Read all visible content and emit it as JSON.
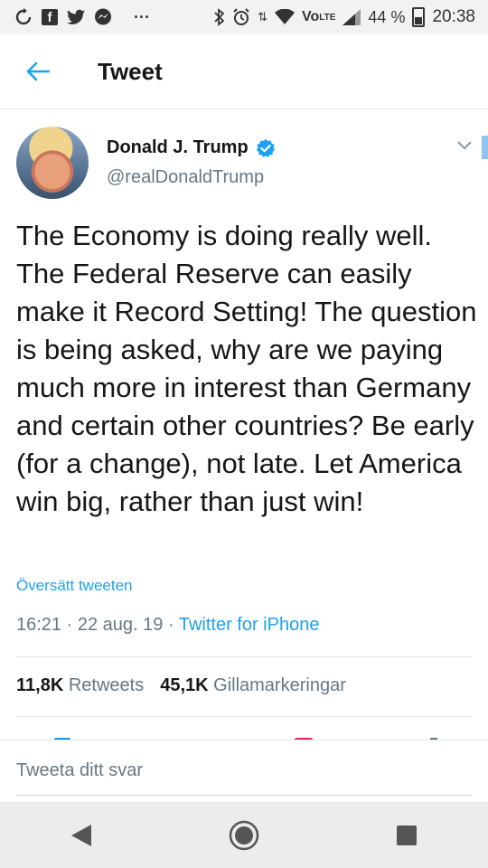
{
  "status_bar": {
    "battery": "44 %",
    "time": "20:38",
    "icons": [
      "sync-icon",
      "facebook-icon",
      "twitter-icon",
      "messenger-icon",
      "more-icon",
      "bluetooth-icon",
      "alarm-icon",
      "data-icon",
      "wifi-icon",
      "volte-icon",
      "signal-icon",
      "battery-icon"
    ]
  },
  "header": {
    "title": "Tweet"
  },
  "tweet": {
    "display_name": "Donald J. Trump",
    "handle": "@realDonaldTrump",
    "verified": true,
    "text": "The Economy is doing really well. The Federal Reserve can easily make it Record Setting! The question is being asked, why are we paying much more in interest than Germany and certain other countries? Be early (for a change), not late. Let America win big, rather than just win!",
    "translate_label": "Översätt tweeten",
    "time": "16:21",
    "date": "22 aug. 19",
    "separator": "·",
    "source": "Twitter for iPhone",
    "retweets_count": "11,8K",
    "retweets_label": "Retweets",
    "likes_count": "45,1K",
    "likes_label": "Gillamarkeringar"
  },
  "reply": {
    "placeholder": "Tweeta ditt svar"
  },
  "colors": {
    "accent": "#1da1f2",
    "secondary_text": "#657786",
    "text": "#14171a",
    "divider": "#e1e8ed"
  }
}
